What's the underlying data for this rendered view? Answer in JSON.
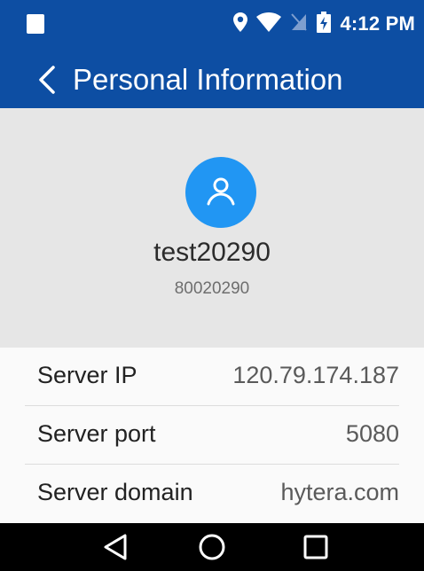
{
  "colors": {
    "header_bg": "#0d4ea3",
    "avatar_bg": "#2196f3",
    "panel_bg": "#e6e6e6",
    "nav_bg": "#000000"
  },
  "status_bar": {
    "time": "4:12 PM",
    "icons": [
      "notification-square-icon",
      "location-icon",
      "wifi-icon",
      "no-sim-icon",
      "battery-charging-icon"
    ]
  },
  "header": {
    "back_icon": "chevron-left-icon",
    "title": "Personal Information"
  },
  "profile": {
    "avatar_icon": "user-icon",
    "name": "test20290",
    "number": "80020290"
  },
  "info": [
    {
      "label": "Server IP",
      "value": "120.79.174.187"
    },
    {
      "label": "Server port",
      "value": "5080"
    },
    {
      "label": "Server domain",
      "value": "hytera.com"
    }
  ],
  "nav": {
    "back_icon": "nav-back-icon",
    "home_icon": "nav-home-icon",
    "recents_icon": "nav-recents-icon"
  }
}
